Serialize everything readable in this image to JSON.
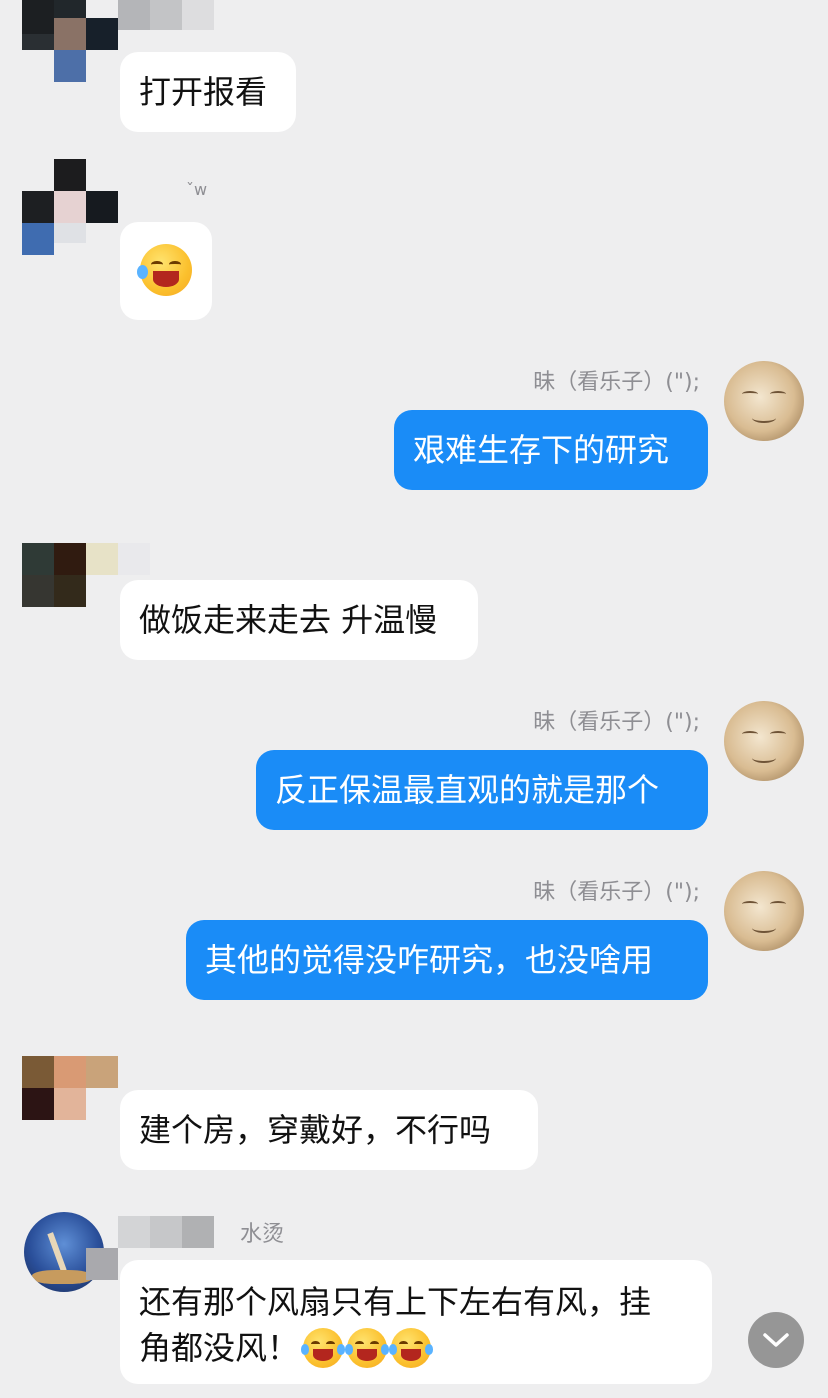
{
  "messages": [
    {
      "id": "m1",
      "direction": "in",
      "sender_name": "",
      "text": "打开报看"
    },
    {
      "id": "m2",
      "direction": "in",
      "sender_name": "ˇw",
      "text": "",
      "emoji": "laughing-tears-emoji"
    },
    {
      "id": "m3",
      "direction": "out",
      "sender_name": "昧（看乐子）(\");",
      "text": "艰难生存下的研究"
    },
    {
      "id": "m4",
      "direction": "in",
      "sender_name": "",
      "text": "做饭走来走去 升温慢"
    },
    {
      "id": "m5",
      "direction": "out",
      "sender_name": "昧（看乐子）(\");",
      "text": "反正保温最直观的就是那个"
    },
    {
      "id": "m6",
      "direction": "out",
      "sender_name": "昧（看乐子）(\");",
      "text": "其他的觉得没咋研究，也没啥用"
    },
    {
      "id": "m7",
      "direction": "in",
      "sender_name": "",
      "text": "建个房，穿戴好，不行吗"
    },
    {
      "id": "m8",
      "direction": "in",
      "sender_name": "水烫",
      "text_line1": "还有那个风扇只有上下左右有风，挂",
      "text_line2": "角都没风！",
      "emoji": "tears-of-joy-emoji"
    }
  ],
  "icons": {
    "scroll_down": "chevron-down-icon"
  },
  "colors": {
    "background": "#eeeeef",
    "incoming_bubble": "#ffffff",
    "outgoing_bubble": "#1a8cf7",
    "name_text": "#8e8e93"
  }
}
